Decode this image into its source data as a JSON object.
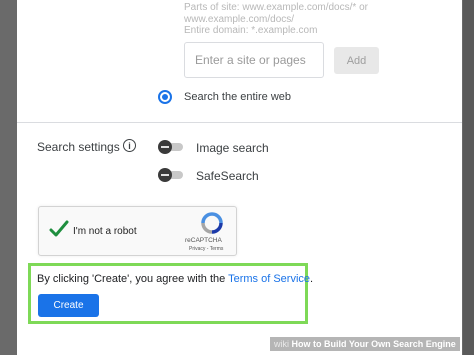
{
  "search_scope": {
    "hint_lines": "Parts of site: www.example.com/docs/* or\nwww.example.com/docs/\nEntire domain: *.example.com",
    "site_placeholder": "Enter a site or pages",
    "add_label": "Add",
    "radio_label": "Search the entire web",
    "radio_checked": true
  },
  "settings": {
    "label": "Search settings",
    "info_glyph": "i",
    "toggles": [
      {
        "label": "Image search",
        "on": false
      },
      {
        "label": "SafeSearch",
        "on": false
      }
    ]
  },
  "recaptcha": {
    "label": "I'm not a robot",
    "brand": "reCAPTCHA",
    "links": "Privacy - Terms",
    "checked": true
  },
  "agreement": {
    "prefix": "By clicking 'Create', you agree with the ",
    "link_text": "Terms of Service",
    "suffix": "."
  },
  "create_label": "Create",
  "watermark": {
    "brand": "wiki",
    "text": "How to Build Your Own Search Engine"
  },
  "colors": {
    "accent": "#1a73e8",
    "highlight": "#7ed957",
    "check": "#1e8e3e"
  }
}
